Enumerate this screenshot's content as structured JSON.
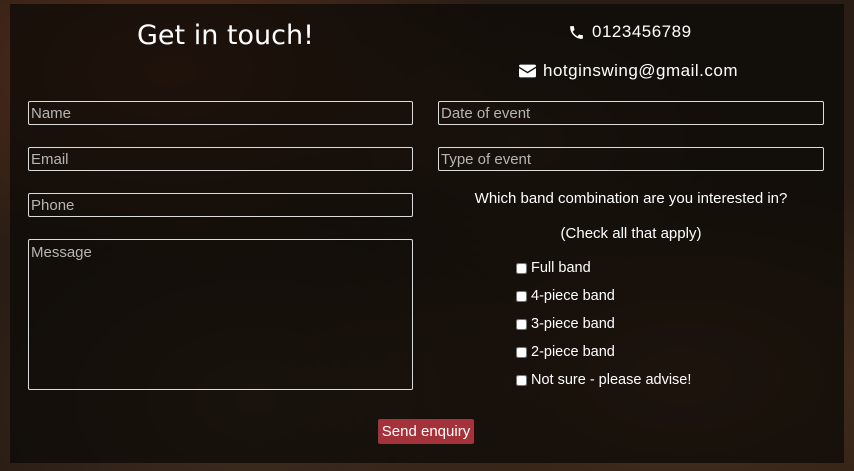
{
  "heading": "Get in touch!",
  "contact": {
    "phone": "0123456789",
    "email": "hotginswing@gmail.com"
  },
  "form": {
    "name_placeholder": "Name",
    "email_placeholder": "Email",
    "phone_placeholder": "Phone",
    "message_placeholder": "Message",
    "date_placeholder": "Date of event",
    "type_placeholder": "Type of event",
    "band_question": "Which band combination are you interested in?",
    "band_hint": "(Check all that apply)",
    "band_options": [
      {
        "label": "Full band",
        "checked": false
      },
      {
        "label": "4-piece band",
        "checked": false
      },
      {
        "label": "3-piece band",
        "checked": false
      },
      {
        "label": "2-piece band",
        "checked": false
      },
      {
        "label": "Not sure - please advise!",
        "checked": false
      }
    ],
    "submit_label": "Send enquiry"
  },
  "colors": {
    "button": "#a3323a",
    "text": "#ffffff",
    "field_border": "#dcdcdc"
  },
  "icons": {
    "phone": "phone-icon",
    "email": "envelope-icon"
  }
}
